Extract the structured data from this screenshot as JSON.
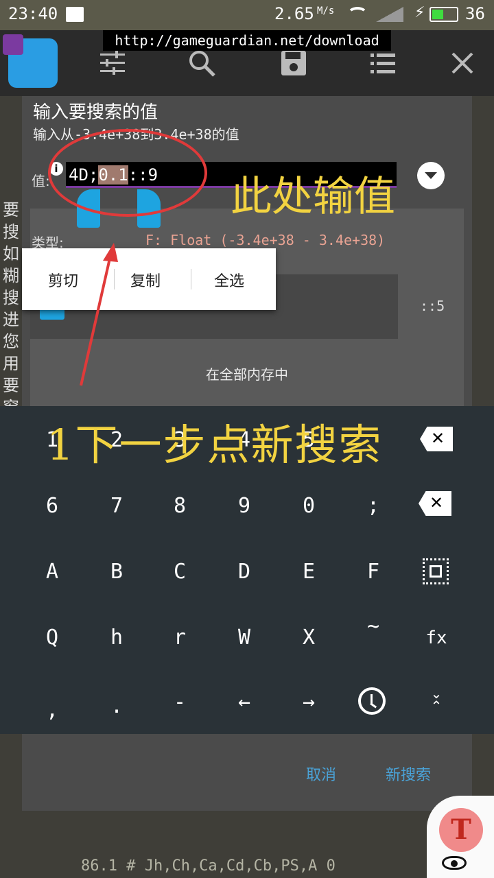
{
  "status": {
    "time": "23:40",
    "speed": "2.65",
    "speed_unit": "M/s",
    "battery": "36"
  },
  "toolbar": {
    "url": "http://gameguardian.net/download"
  },
  "dialog": {
    "title": "输入要搜索的值",
    "subtitle": "输入从-3.4e+38到3.4e+38的值",
    "value_label": "值:",
    "value_prefix": "4D;",
    "value_selected": "0.1",
    "value_suffix": "::9",
    "type_label": "类型:",
    "type_value": "F: Float (-3.4e+38 - 3.4e+38)",
    "range_value": "::5",
    "memory_label": "在全部内存中",
    "cancel": "取消",
    "new_search": "新搜索"
  },
  "context_menu": {
    "cut": "剪切",
    "copy": "复制",
    "select_all": "全选"
  },
  "keyboard": {
    "row1": [
      "1",
      "2",
      "3",
      "4",
      "5"
    ],
    "row2": [
      "6",
      "7",
      "8",
      "9",
      "0",
      ";"
    ],
    "row3": [
      "A",
      "B",
      "C",
      "D",
      "E",
      "F"
    ],
    "row4": [
      "Q",
      "h",
      "r",
      "W",
      "X",
      "~",
      "fx"
    ],
    "row5": [
      ",",
      ".",
      "-",
      "←",
      "→"
    ]
  },
  "annotations": {
    "input_hint": "此处输值",
    "next_step": "1下一步点新搜索"
  },
  "background": {
    "side_text": "要搜如糊搜进您用要窗",
    "bottom_text": "86.1 # Jh,Ch,Ca,Cd,Cb,PS,A 0"
  },
  "colors": {
    "accent": "#1ea4e0",
    "button_text": "#4aa3d8",
    "annotation": "#f2d341",
    "circle": "#e03a3a"
  }
}
